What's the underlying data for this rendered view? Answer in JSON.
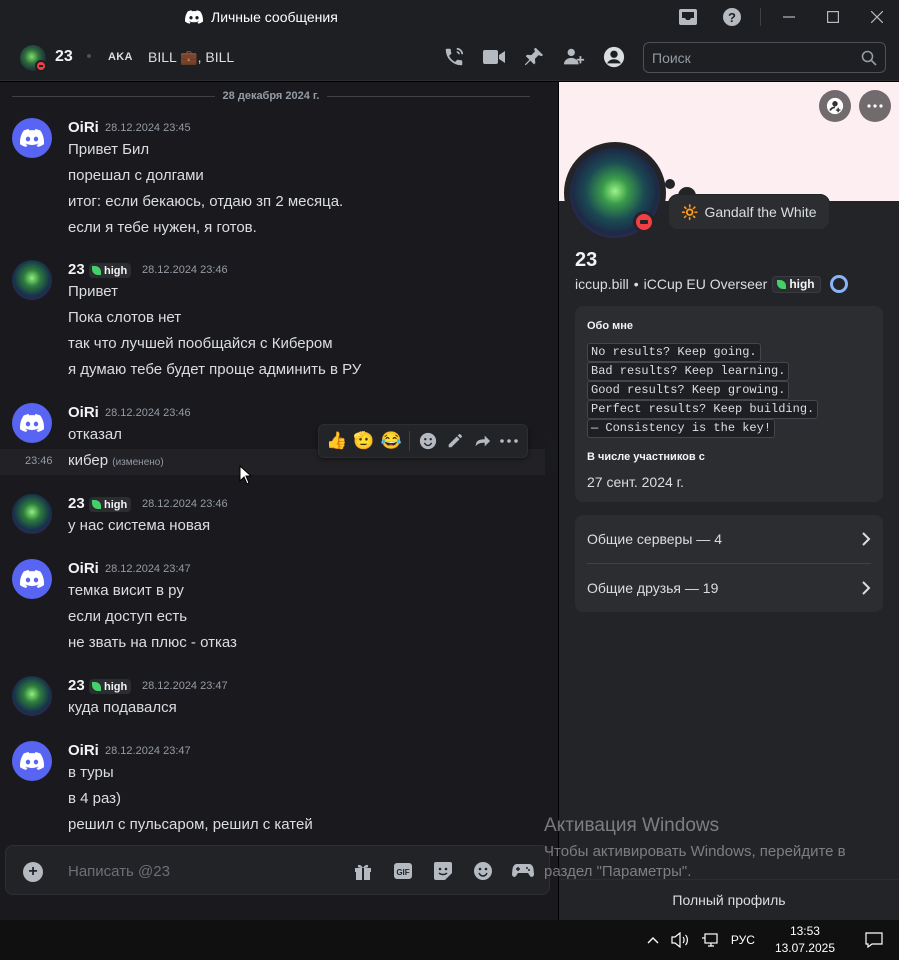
{
  "window": {
    "title": "Личные сообщения"
  },
  "header": {
    "name": "23",
    "aka": "AKA",
    "aliases": "BILL 💼, BILL",
    "search_placeholder": "Поиск"
  },
  "chat": {
    "date_divider": "28 декабря 2024 г.",
    "groups": [
      {
        "author": "OiRi",
        "avatar": "discord-logo",
        "tag": "",
        "time": "28.12.2024 23:45",
        "lines": [
          "Привет Бил",
          "порешал с долгами",
          "итог: если бекаюсь, отдаю зп 2 месяца.",
          "если я тебе нужен, я готов."
        ]
      },
      {
        "author": "23",
        "avatar": "user-avatar",
        "tag": "high",
        "time": "28.12.2024 23:46",
        "lines": [
          "Привет",
          "Пока слотов нет",
          "так что лучшей пообщайся с Кибером",
          "я думаю тебе будет проще админить в РУ"
        ]
      },
      {
        "author": "OiRi",
        "avatar": "discord-logo",
        "tag": "",
        "time": "28.12.2024 23:46",
        "lines": [
          "отказал"
        ],
        "followup": {
          "time": "23:46",
          "text": "кибер",
          "edited": "(изменено)"
        }
      },
      {
        "author": "23",
        "avatar": "user-avatar",
        "tag": "high",
        "time": "28.12.2024 23:46",
        "lines": [
          "у нас система новая"
        ]
      },
      {
        "author": "OiRi",
        "avatar": "discord-logo",
        "tag": "",
        "time": "28.12.2024 23:47",
        "lines": [
          "темка висит в ру",
          "если доступ есть",
          "не звать на плюс - отказ"
        ]
      },
      {
        "author": "23",
        "avatar": "user-avatar",
        "tag": "high",
        "time": "28.12.2024 23:47",
        "lines": [
          "куда подавался"
        ]
      },
      {
        "author": "OiRi",
        "avatar": "discord-logo",
        "tag": "",
        "time": "28.12.2024 23:47",
        "lines": [
          "в туры",
          "в 4 раз)",
          "решил с пульсаром, решил с катей"
        ]
      }
    ],
    "reactions": [
      "👍",
      "🫡",
      "😂"
    ],
    "composer_placeholder": "Написать @23"
  },
  "profile": {
    "custom_status_emoji": "🔆",
    "custom_status": "Gandalf the White",
    "display_name": "23",
    "username": "iccup.bill",
    "bullet": "•",
    "subtitle": "iCCup EU Overseer",
    "tag": "high",
    "about_heading": "Обо мне",
    "about_lines": [
      "No results? Keep going.",
      "Bad results? Keep learning.",
      "Good results? Keep growing.",
      "Perfect results? Keep building.",
      "— Consistency is the key!"
    ],
    "member_heading": "В числе участников с",
    "member_since": "27 сент. 2024 г.",
    "mutual_servers": "Общие серверы — 4",
    "mutual_friends": "Общие друзья — 19",
    "full_profile": "Полный профиль",
    "banner_color": "#fdeef1"
  },
  "watermark": {
    "title": "Активация Windows",
    "line1": "Чтобы активировать Windows, перейдите в",
    "line2": "раздел \"Параметры\"."
  },
  "taskbar": {
    "lang": "РУС",
    "time": "13:53",
    "date": "13.07.2025"
  },
  "colors": {
    "accent": "#5865f2",
    "dnd": "#f23f43",
    "tag_leaf": "#44d06b"
  }
}
